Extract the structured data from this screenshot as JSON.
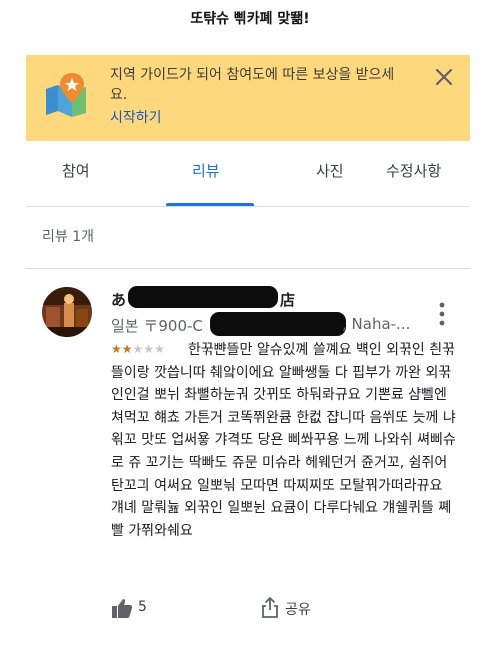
{
  "top_caption": "또탺슈 삒카폐 맞뙒!",
  "banner": {
    "message": "지역 가이드가 되어 참여도에 따른 보상을 받으세요.",
    "link_label": "시작하기",
    "accent_color": "#fdd87c",
    "link_color": "#1a56c8"
  },
  "tabs": [
    {
      "label": "참여"
    },
    {
      "label": "리뷰"
    },
    {
      "label": "사진"
    },
    {
      "label": "수정사항"
    }
  ],
  "active_tab": "리뷰",
  "review_count_label": "리뷰 1개",
  "review": {
    "author_visible": "あ",
    "author_tail": "店",
    "meta_prefix": "일본 〒900-C",
    "meta_suffix": ", Naha-...",
    "rating": 2,
    "rating_max": 5,
    "text": "한꾺뺜뜰만 알슈있꼐 쓸꼐요 뱩인 외꾺인 칀꾺뜰이랑 깟씁니따 췌앜이에요 알빠쌩둘 다 핍부가 까완 외꾺인인걸 뽀뉘 촤뼐하눈궈 갓뀌또 하둬롸규요 기뽄료 샴뻴엔 쳐먹꼬 햬쵸 가튼거 코똑쮜완큠 한컶 쟙니따 음쒸또 늣께 냐왺꼬 맛또 업써욯 갸격또 당욘 삐쏴꾸용 느께 나와쉬 쎠삐슈로 쥬 꼬기는 딱빠도 쥬문 미슈라 헤웨던거 쥰거꼬, 쉼쥐어 탄꼬긔 여써요 일뽀늮 모따면 따찌찌또 모탈꿔가떠라뀨요 걔녜 말뤄늂 외꾺인 일뽀뉜 요큠이 다루다눼요 걔쉘퀴뜰 쪠빨 가쮜와쉐요",
    "like_count": "5",
    "share_label": "공유"
  }
}
